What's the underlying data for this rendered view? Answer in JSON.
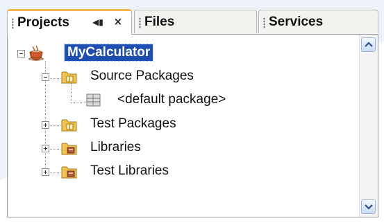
{
  "tabs": [
    {
      "label": "Projects",
      "active": true
    },
    {
      "label": "Files",
      "active": false
    },
    {
      "label": "Services",
      "active": false
    }
  ],
  "tab_tools": {
    "minimize_glyph": "◀▮",
    "close_glyph": "×"
  },
  "tree": {
    "root": {
      "label": "MyCalculator",
      "icon": "coffee-cup-project-icon",
      "expanded": true,
      "selected": true
    },
    "children": [
      {
        "label": "Source Packages",
        "icon": "folder-package-icon",
        "expanded": true,
        "children": [
          {
            "label": "<default package>",
            "icon": "package-icon"
          }
        ]
      },
      {
        "label": "Test Packages",
        "icon": "folder-package-icon",
        "expanded": false
      },
      {
        "label": "Libraries",
        "icon": "folder-library-icon",
        "expanded": false
      },
      {
        "label": "Test Libraries",
        "icon": "folder-library-icon",
        "expanded": false
      }
    ]
  },
  "colors": {
    "accent": "#f5b54a",
    "selection": "#1e4fb0",
    "border": "#9a9a9a"
  }
}
